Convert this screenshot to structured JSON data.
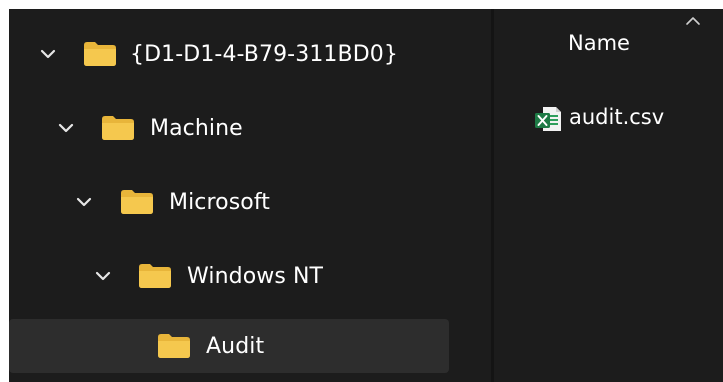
{
  "tree": {
    "items": [
      {
        "label": "{D1-D1-4-B79-311BD0}",
        "expanded": true,
        "depth": 0,
        "icon": "folder-icon"
      },
      {
        "label": "Machine",
        "expanded": true,
        "depth": 1,
        "icon": "folder-icon"
      },
      {
        "label": "Microsoft",
        "expanded": true,
        "depth": 2,
        "icon": "folder-icon"
      },
      {
        "label": "Windows NT",
        "expanded": true,
        "depth": 3,
        "icon": "folder-icon"
      },
      {
        "label": "Audit",
        "expanded": false,
        "depth": 4,
        "icon": "folder-icon",
        "selected": true
      }
    ]
  },
  "file_list": {
    "columns": [
      {
        "label": "Name",
        "sorted": "ascending"
      }
    ],
    "files": [
      {
        "name": "audit.csv",
        "icon": "excel-csv-icon"
      }
    ]
  },
  "colors": {
    "background": "#1c1c1c",
    "selected_row": "#2d2d2d",
    "folder": "#f0c44c",
    "excel_green": "#1d7a45",
    "text": "#ffffff"
  }
}
